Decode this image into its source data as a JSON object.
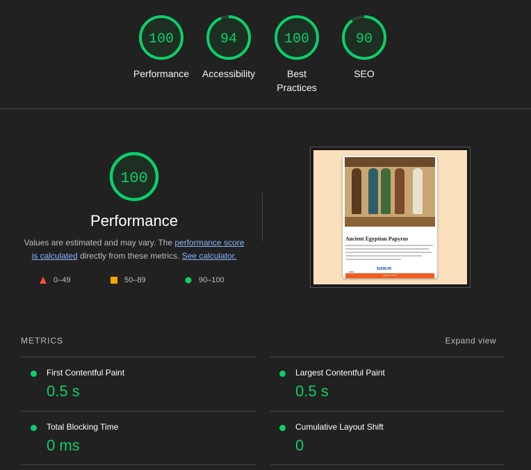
{
  "summary": {
    "gauges": [
      {
        "score": "100",
        "label": "Performance",
        "fraction": 1.0
      },
      {
        "score": "94",
        "label": "Accessibility",
        "fraction": 0.94
      },
      {
        "score": "100",
        "label": "Best Practices",
        "fraction": 1.0
      },
      {
        "score": "90",
        "label": "SEO",
        "fraction": 0.9
      }
    ]
  },
  "performance": {
    "score": "100",
    "title": "Performance",
    "desc_prefix": "Values are estimated and may vary. The ",
    "link_score": "performance score is calculated",
    "desc_middle": " directly from these metrics. ",
    "link_calc": "See calculator.",
    "legend": [
      {
        "range": "0–49",
        "shape": "triangle",
        "color": "#ff4e42"
      },
      {
        "range": "50–89",
        "shape": "square",
        "color": "#ffa400"
      },
      {
        "range": "90–100",
        "shape": "circle",
        "color": "#0cce6b"
      }
    ]
  },
  "screenshot": {
    "product_title": "Ancient Egyptian Papyrus",
    "price": "$1599.99",
    "button": "ADD TO CART"
  },
  "metrics": {
    "header": "METRICS",
    "expand": "Expand view",
    "items": [
      {
        "title": "First Contentful Paint",
        "value": "0.5 s"
      },
      {
        "title": "Largest Contentful Paint",
        "value": "0.5 s"
      },
      {
        "title": "Total Blocking Time",
        "value": "0 ms"
      },
      {
        "title": "Cumulative Layout Shift",
        "value": "0"
      }
    ]
  },
  "colors": {
    "pass": "#0cce6b",
    "background": "#212121",
    "link": "#8ab4f8"
  }
}
